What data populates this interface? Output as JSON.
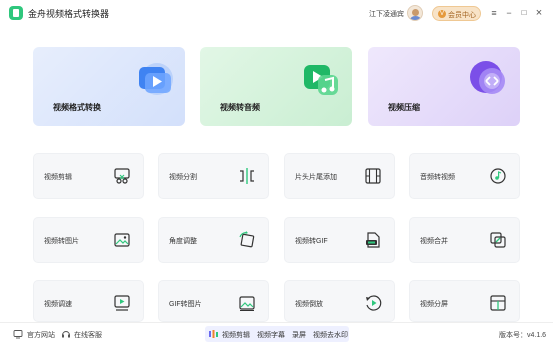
{
  "app": {
    "title": "金舟视频格式转换器"
  },
  "header": {
    "user_name": "江下凌通宾",
    "vip_label": "会员中心",
    "vip_icon": "V",
    "menu_icon": "≡",
    "minimize_icon": "−",
    "maximize_icon": "□",
    "close_icon": "×"
  },
  "features": [
    {
      "label": "视频格式转换",
      "bg": "#dde7fb",
      "accent": "#3a7df0"
    },
    {
      "label": "视频转音频",
      "bg": "#d9f4df",
      "accent": "#26b36a"
    },
    {
      "label": "视频压缩",
      "bg": "#e9e1fa",
      "accent": "#7b55e8"
    }
  ],
  "tools": [
    {
      "label": "视频剪辑",
      "icon": "scissors-icon"
    },
    {
      "label": "视频分割",
      "icon": "split-icon"
    },
    {
      "label": "片头片尾添加",
      "icon": "film-icon"
    },
    {
      "label": "音频转视频",
      "icon": "music-icon"
    },
    {
      "label": "视频转图片",
      "icon": "image-icon"
    },
    {
      "label": "角度调整",
      "icon": "rotate-icon"
    },
    {
      "label": "视频转GIF",
      "icon": "gif-icon"
    },
    {
      "label": "视频合并",
      "icon": "merge-icon"
    },
    {
      "label": "视频调速",
      "icon": "speed-icon"
    },
    {
      "label": "GIF转图片",
      "icon": "gif-image-icon"
    },
    {
      "label": "视频倒放",
      "icon": "reverse-icon"
    },
    {
      "label": "视频分屏",
      "icon": "splitscreen-icon"
    }
  ],
  "statusbar": {
    "website": "官方网站",
    "support": "在线客服",
    "marquee": [
      "视频剪辑",
      "视频字幕",
      "录屏",
      "视频去水印"
    ],
    "version": "版本号：v4.1.6"
  }
}
